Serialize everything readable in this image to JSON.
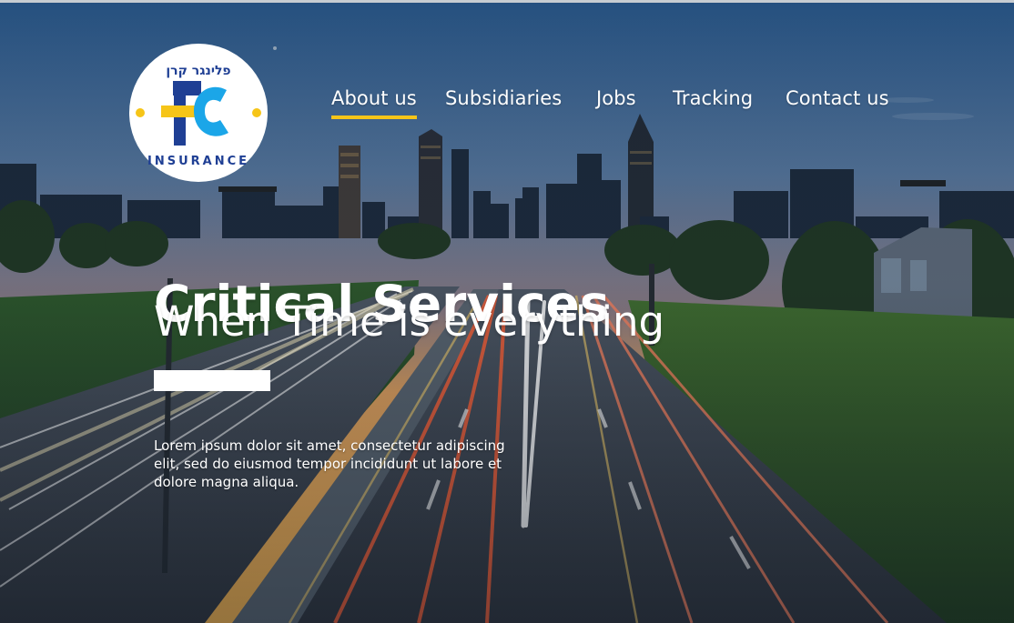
{
  "brand": {
    "logo_label": "fc",
    "logo_ring_text_top": "פלינגר קרן",
    "logo_ring_text_bottom": "INSURANCE",
    "colors": {
      "navy": "#1f3f94",
      "cyan": "#1ba6e8",
      "yellow": "#f6c518"
    }
  },
  "nav": {
    "items": [
      {
        "label": "About us",
        "active": true
      },
      {
        "label": "Subsidiaries",
        "active": false
      },
      {
        "label": "Jobs",
        "active": false
      },
      {
        "label": "Tracking",
        "active": false
      },
      {
        "label": "Contact us",
        "active": false
      }
    ]
  },
  "hero": {
    "headline": "Critical Services",
    "subheadline": "When Time is everything",
    "body": "Lorem ipsum dolor sit amet, consectetur adipiscing elit, sed do eiusmod tempor incididunt ut labore et dolore magna aliqua."
  }
}
